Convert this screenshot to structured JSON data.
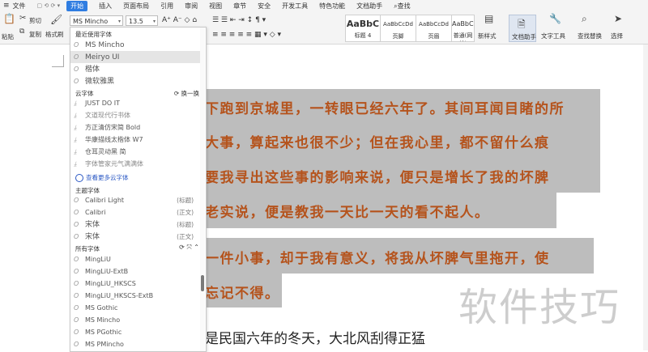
{
  "menubar": {
    "file": "文件",
    "start": "开始",
    "items": [
      "插入",
      "页面布局",
      "引用",
      "审阅",
      "视图",
      "章节",
      "安全",
      "开发工具",
      "特色功能",
      "文档助手"
    ],
    "search": "查找"
  },
  "ribbon": {
    "cut": "剪切",
    "paste": "粘贴",
    "copy": "复制",
    "format_painter": "格式刷",
    "font_name": "MS Mincho",
    "font_size": "13.5",
    "styles": [
      {
        "sample": "AaBbC",
        "name": "标题 4"
      },
      {
        "sample": "AaBbCcDd",
        "name": "页脚"
      },
      {
        "sample": "AaBbCcDd",
        "name": "页眉"
      },
      {
        "sample": "AaBbCcDd",
        "name": "普通(网站)"
      }
    ],
    "new_style": "新样式",
    "doc_assistant": "文档助手",
    "text_tools": "文字工具",
    "find_replace": "查找替换",
    "select": "选择"
  },
  "font_dropdown": {
    "recent_title": "最近使用字体",
    "recent": [
      "MS Mincho",
      "Meiryo UI",
      "楷体",
      "微软雅黑"
    ],
    "cloud_title": "云字体",
    "cloud_refresh": "换一换",
    "cloud": [
      "JUST DO IT",
      "文道现代行书体",
      "方正清仿宋简 Bold",
      "华康描线太楷体 W7",
      "仓耳灵动黑 简",
      "字体管家元气满满体"
    ],
    "cloud_more": "查看更多云字体",
    "theme_title": "主题字体",
    "theme": [
      {
        "name": "Calibri Light",
        "tag": "(标题)"
      },
      {
        "name": "Calibri",
        "tag": "(正文)"
      },
      {
        "name": "宋体",
        "tag": "(标题)"
      },
      {
        "name": "宋体",
        "tag": "(正文)"
      }
    ],
    "all_title": "所有字体",
    "all": [
      "MingLiU",
      "MingLiU-ExtB",
      "MingLiU_HKSCS",
      "MingLiU_HKSCS-ExtB",
      "MS Gothic",
      "MS Mincho",
      "MS PGothic",
      "MS PMincho"
    ]
  },
  "document": {
    "lines": [
      "下跑到京城里，一转眼已经六年了。其间耳闻目睹的所",
      "大事，算起来也很不少；但在我心里，都不留什么痕",
      "要我寻出这些事的影响来说，便只是增长了我的坏脾",
      "老实说，便是教我一天比一天的看不起人。",
      "一件小事，却于我有意义，将我从坏脾气里拖开，使",
      "忘记不得。"
    ],
    "plain_line": "是民国六年的冬天，大北风刮得正猛"
  },
  "watermark": "软件技巧"
}
